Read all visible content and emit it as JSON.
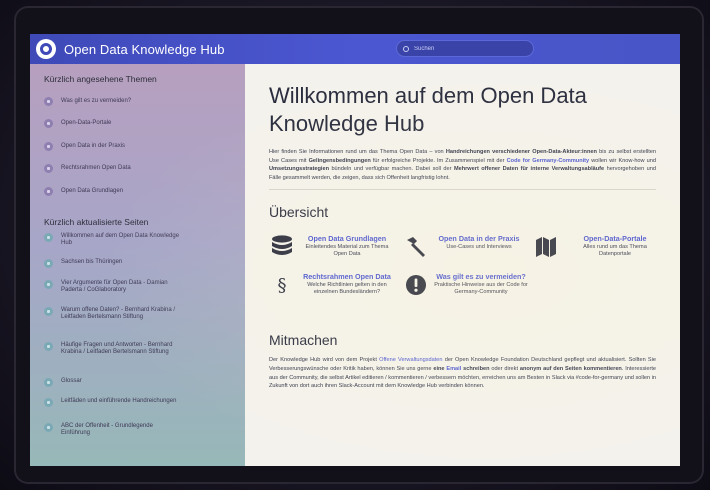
{
  "app": {
    "title": "Open Data Knowledge Hub"
  },
  "search": {
    "placeholder": "Suchen"
  },
  "sidebar": {
    "recent_heading": "Kürzlich angesehene Themen",
    "recent_items": [
      {
        "label": "Was gilt es zu vermeiden?"
      },
      {
        "label": "Open-Data-Portale"
      },
      {
        "label": "Open Data in der Praxis"
      },
      {
        "label": "Rechtsrahmen Open Data"
      },
      {
        "label": "Open Data Grundlagen"
      }
    ],
    "updated_heading": "Kürzlich aktualisierte Seiten",
    "updated_items": [
      {
        "label": "Willkommen auf dem Open Data Knowledge Hub"
      },
      {
        "label": "Sachsen bis Thüringen"
      },
      {
        "label": "Vier Argumente für Open Data - Damian Paderta / CoGlaboratory"
      },
      {
        "label": "Warum offene Daten? - Bernhard Krabina / Leitfaden Bertelsmann Stiftung"
      },
      {
        "label": "Häufige Fragen und Antworten - Bernhard Krabina / Leitfaden Bertelsmann Stiftung"
      },
      {
        "label": "Glossar"
      },
      {
        "label": "Leitfäden und einführende Handreichungen"
      },
      {
        "label": "ABC der Offenheit - Grundlegende Einführung"
      }
    ]
  },
  "main": {
    "title": "Willkommen auf dem Open Data Knowledge Hub",
    "intro": {
      "t1": "Hier finden Sie Informationen rund um das Thema Open Data – von ",
      "b1": "Handreichungen verschiedener Open-Data-Akteur:innen",
      "t2": " bis zu selbst erstellten Use Cases mit ",
      "b2": "Gelingensbedingungen",
      "t3": " für erfolgreiche Projekte. Im Zusammenspiel mit der ",
      "link": "Code for Germany-Community",
      "t4": " wollen wir Know-how und ",
      "b3": "Umsetzungsstrategien",
      "t5": " bündeln und verfügbar machen. Dabei soll der ",
      "b4": "Mehrwert offener Daten für interne Verwaltungsabläufe",
      "t6": " hervorgehoben und Fälle gesammelt werden, die zeigen, dass sich Offenheit langfristig lohnt."
    },
    "overview_title": "Übersicht",
    "cards": [
      {
        "title": "Open Data Grundlagen",
        "desc": "Einleitendes Material zum Thema Open Data"
      },
      {
        "title": "Open Data in der Praxis",
        "desc": "Use-Cases und Interviews"
      },
      {
        "title": "Open-Data-Portale",
        "desc": "Alles rund um das Thema Datenportale"
      },
      {
        "title": "Rechtsrahmen Open Data",
        "desc": "Welche Richtlinien gelten in den einzelnen Bundesländern?"
      },
      {
        "title": "Was gilt es zu vermeiden?",
        "desc": "Praktische Hinweise aus der Code for Germany-Community"
      }
    ],
    "mitmachen_title": "Mitmachen",
    "mitmachen": {
      "t1": "Der Knowledge Hub wird von dem Projekt ",
      "link1": "Offene Verwaltungsdaten",
      "t2": " der Open Knowledge Foundation Deutschland gepflegt und aktualisiert. Sollten Sie Verbesserungswünsche oder Kritik haben, können Sie uns gerne ",
      "b1": "eine",
      "t3": " ",
      "link2": "Email",
      "t4": " ",
      "b2": "schreiben",
      "t5": " oder direkt ",
      "b3": "anonym auf den Seiten kommentieren",
      "t6": ". Interessierte aus der Community, die selbst Artikel editieren / kommentieren / verbessern möchten, erreichen uns am Besten in Slack via #code-for-germany und sollen in Zukunft von dort auch ihren Slack-Account mit dem Knowledge Hub verbinden können."
    }
  }
}
